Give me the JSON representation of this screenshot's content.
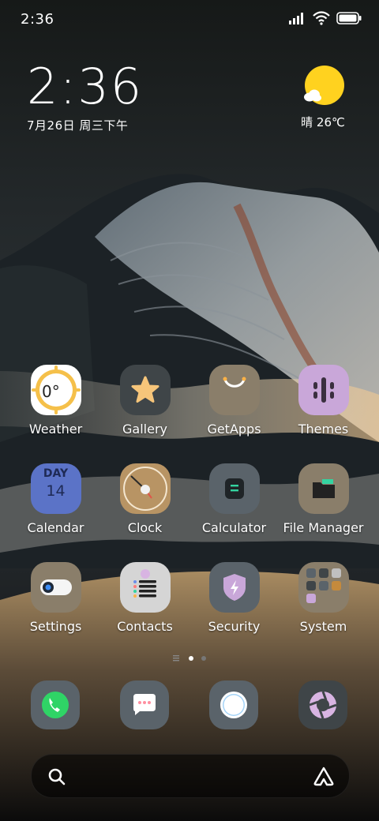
{
  "status_bar": {
    "time": "2:36",
    "icons": [
      "signal-icon",
      "wifi-icon",
      "battery-icon"
    ]
  },
  "clock_widget": {
    "time": "2:36",
    "date": "7月26日 周三下午"
  },
  "weather_widget": {
    "temperature_text": "晴 26℃",
    "icon": "sun-cloud-icon"
  },
  "apps": [
    {
      "label": "Weather",
      "icon": "weather-icon",
      "badge": "0°"
    },
    {
      "label": "Gallery",
      "icon": "gallery-star-icon"
    },
    {
      "label": "GetApps",
      "icon": "getapps-bag-icon"
    },
    {
      "label": "Themes",
      "icon": "themes-brush-icon"
    },
    {
      "label": "Calendar",
      "icon": "calendar-icon",
      "day_label": "DAY",
      "day_number": "14"
    },
    {
      "label": "Clock",
      "icon": "clock-icon"
    },
    {
      "label": "Calculator",
      "icon": "calculator-icon"
    },
    {
      "label": "File Manager",
      "icon": "folder-icon"
    },
    {
      "label": "Settings",
      "icon": "settings-toggle-icon"
    },
    {
      "label": "Contacts",
      "icon": "contacts-icon"
    },
    {
      "label": "Security",
      "icon": "security-shield-icon"
    },
    {
      "label": "System",
      "icon": "system-folder-icon"
    }
  ],
  "page_indicator": {
    "pages": 2,
    "active": 1
  },
  "dock": [
    "phone-icon",
    "messages-icon",
    "browser-icon",
    "camera-icon"
  ],
  "search_bar": {
    "left_icon": "search-icon",
    "right_icon": "assistant-icon"
  },
  "colors": {
    "accent_green": "#2fd466",
    "sun_yellow": "#ffd21f",
    "icon_slate": "#5a636a",
    "icon_tan": "#8a7e6a",
    "icon_lavender": "#c9a7d9",
    "icon_blue": "#5b73c7"
  }
}
